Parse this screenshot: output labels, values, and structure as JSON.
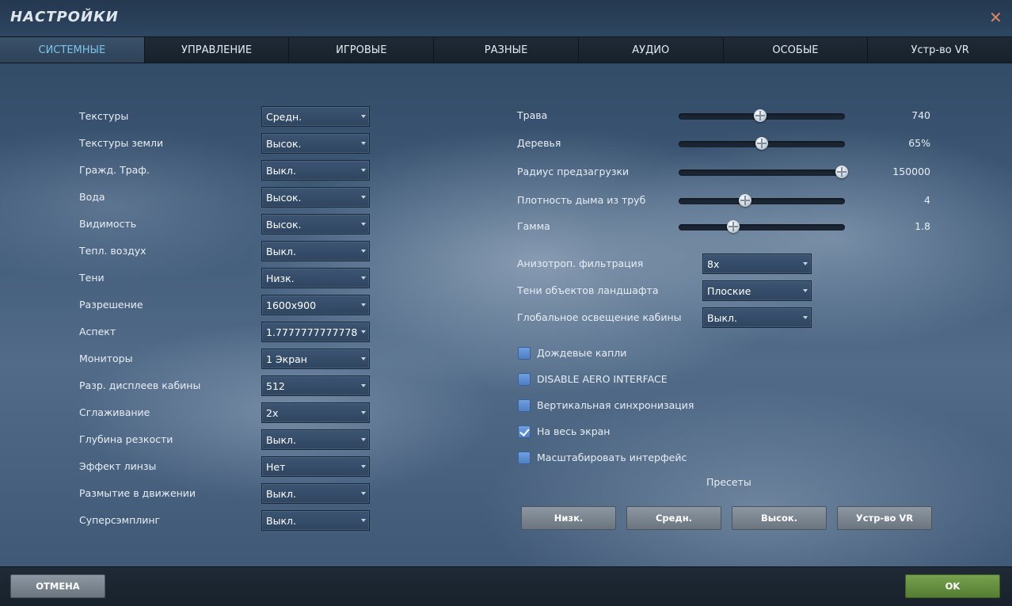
{
  "window": {
    "title": "НАСТРОЙКИ",
    "close_icon": "close-icon",
    "accent_color": "#7ec3e8",
    "ok_color": "#6a9443"
  },
  "tabs": [
    {
      "label": "СИСТЕМНЫЕ",
      "active": true
    },
    {
      "label": "УПРАВЛЕНИЕ",
      "active": false
    },
    {
      "label": "ИГРОВЫЕ",
      "active": false
    },
    {
      "label": "РАЗНЫЕ",
      "active": false
    },
    {
      "label": "АУДИО",
      "active": false
    },
    {
      "label": "ОСОБЫЕ",
      "active": false
    },
    {
      "label": "Устр-во VR",
      "active": false
    }
  ],
  "left_settings": [
    {
      "label": "Текстуры",
      "value": "Средн."
    },
    {
      "label": "Текстуры земли",
      "value": "Высок."
    },
    {
      "label": "Гражд. Траф.",
      "value": "Выкл."
    },
    {
      "label": "Вода",
      "value": "Высок."
    },
    {
      "label": "Видимость",
      "value": "Высок."
    },
    {
      "label": "Тепл. воздух",
      "value": "Выкл."
    },
    {
      "label": "Тени",
      "value": "Низк."
    },
    {
      "label": "Разрешение",
      "value": "1600x900"
    },
    {
      "label": "Аспект",
      "value": "1.7777777777778"
    },
    {
      "label": "Мониторы",
      "value": "1 Экран"
    },
    {
      "label": "Разр. дисплеев кабины",
      "value": "512"
    },
    {
      "label": "Сглаживание",
      "value": "2x"
    },
    {
      "label": "Глубина резкости",
      "value": "Выкл."
    },
    {
      "label": "Эффект линзы",
      "value": "Нет"
    },
    {
      "label": "Размытие в движении",
      "value": "Выкл."
    },
    {
      "label": "Суперсэмплинг",
      "value": "Выкл."
    }
  ],
  "sliders": [
    {
      "label": "Трава",
      "value": "740",
      "fraction": 0.49
    },
    {
      "label": "Деревья",
      "value": "65%",
      "fraction": 0.5
    },
    {
      "label": "Радиус предзагрузки",
      "value": "150000",
      "fraction": 0.98
    },
    {
      "label": "Плотность дыма из труб",
      "value": "4",
      "fraction": 0.4
    },
    {
      "label": "Гамма",
      "value": "1.8",
      "fraction": 0.33
    }
  ],
  "right_settings": [
    {
      "label": "Анизотроп. фильтрация",
      "value": "8x"
    },
    {
      "label": "Тени объектов ландшафта",
      "value": "Плоские"
    },
    {
      "label": "Глобальное освещение кабины",
      "value": "Выкл."
    }
  ],
  "checkboxes": [
    {
      "label": "Дождевые капли",
      "checked": false
    },
    {
      "label": "DISABLE AERO INTERFACE",
      "checked": false
    },
    {
      "label": "Вертикальная синхронизация",
      "checked": false
    },
    {
      "label": "На весь экран",
      "checked": true
    },
    {
      "label": "Масштабировать интерфейс",
      "checked": false
    }
  ],
  "presets": {
    "title": "Пресеты",
    "buttons": [
      "Низк.",
      "Средн.",
      "Высок.",
      "Устр-во VR"
    ]
  },
  "footer": {
    "cancel_label": "ОТМЕНА",
    "ok_label": "OK"
  }
}
